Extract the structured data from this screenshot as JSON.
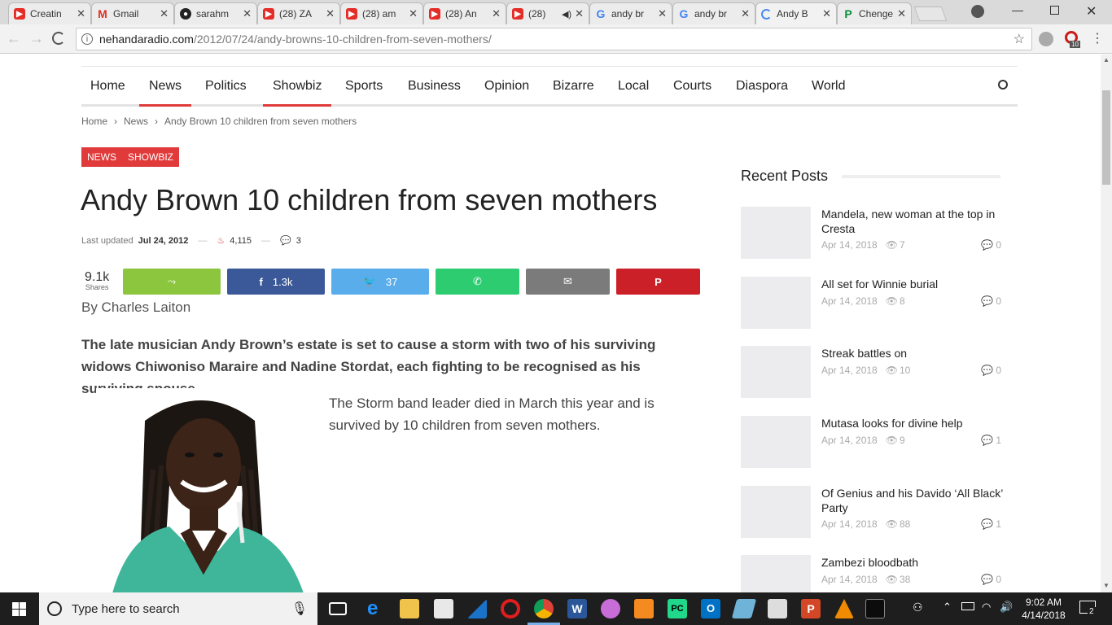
{
  "browser": {
    "tabs": [
      {
        "title": "Creatin",
        "icon": "youtube-icon"
      },
      {
        "title": "Gmail",
        "icon": "gmail-icon"
      },
      {
        "title": "sarahm",
        "icon": "github-icon"
      },
      {
        "title": "(28) ZA",
        "icon": "youtube-icon"
      },
      {
        "title": "(28) am",
        "icon": "youtube-icon"
      },
      {
        "title": "(28) An",
        "icon": "youtube-icon"
      },
      {
        "title": "(28)",
        "icon": "youtube-icon"
      },
      {
        "title": "andy br",
        "icon": "google-icon"
      },
      {
        "title": "andy br",
        "icon": "google-icon"
      },
      {
        "title": "Andy B",
        "icon": "loading-icon"
      },
      {
        "title": "Chenge",
        "icon": "p-icon"
      }
    ],
    "url_host": "nehandaradio.com",
    "url_path": "/2012/07/24/andy-browns-10-children-from-seven-mothers/",
    "ext_badge": "10"
  },
  "nav": {
    "items": [
      "Home",
      "News",
      "Politics",
      "Showbiz",
      "Sports",
      "Business",
      "Opinion",
      "Bizarre",
      "Local",
      "Courts",
      "Diaspora",
      "World"
    ]
  },
  "breadcrumb": {
    "home": "Home",
    "section": "News",
    "current": "Andy Brown 10 children from seven mothers"
  },
  "badges": {
    "news": "NEWS",
    "showbiz": "SHOWBIZ"
  },
  "article": {
    "title": "Andy Brown 10 children from seven mothers",
    "updated_label": "Last updated",
    "updated_date": "Jul 24, 2012",
    "views": "4,115",
    "comments": "3",
    "shares_count": "9.1k",
    "shares_label": "Shares",
    "facebook_count": "1.3k",
    "twitter_count": "37",
    "byline": "By Charles Laiton",
    "lead": "The late musician Andy Brown’s estate is set to cause a storm with two of his surviving widows Chiwoniso Maraire and Nadine Stordat, each fighting to be recognised as his surviving spouse.",
    "para": "The Storm band leader died in March this year and is survived by 10 children from seven mothers."
  },
  "sidebar": {
    "heading": "Recent Posts",
    "posts": [
      {
        "title": "Mandela, new woman at the top in Cresta",
        "date": "Apr 14, 2018",
        "views": "7",
        "comments": "0"
      },
      {
        "title": "All set for Winnie burial",
        "date": "Apr 14, 2018",
        "views": "8",
        "comments": "0"
      },
      {
        "title": "Streak battles on",
        "date": "Apr 14, 2018",
        "views": "10",
        "comments": "0"
      },
      {
        "title": "Mutasa looks for divine help",
        "date": "Apr 14, 2018",
        "views": "9",
        "comments": "1"
      },
      {
        "title": "Of Genius and his Davido ‘All Black’ Party",
        "date": "Apr 14, 2018",
        "views": "88",
        "comments": "1"
      },
      {
        "title": "Zambezi bloodbath",
        "date": "Apr 14, 2018",
        "views": "38",
        "comments": "0"
      }
    ]
  },
  "taskbar": {
    "search_placeholder": "Type here to search",
    "time": "9:02 AM",
    "date": "4/14/2018",
    "notif_count": "2"
  },
  "colors": {
    "accent": "#e03a3a",
    "share": "#8cc63e",
    "facebook": "#3b5998",
    "twitter": "#59adeb",
    "whatsapp": "#2ecc71",
    "email": "#7b7b7b",
    "pinterest": "#cb2027"
  }
}
